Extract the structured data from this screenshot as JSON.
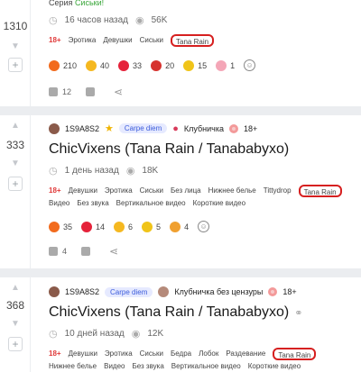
{
  "post1": {
    "votes": "1310",
    "series_label": "Серия",
    "series_name": "Сиськи!",
    "time": "16 часов назад",
    "views": "56K",
    "tags": [
      "18+",
      "Эротика",
      "Девушки",
      "Сиськи",
      "Tana Rain"
    ],
    "highlight_tag_index": 4,
    "reactions": [
      {
        "icon": "fire-emoji-icon",
        "color": "#f26b1d",
        "count": "210"
      },
      {
        "icon": "heart-eyes-emoji-icon",
        "color": "#f5b820",
        "count": "40"
      },
      {
        "icon": "heart-emoji-icon",
        "color": "#e5223a",
        "count": "33"
      },
      {
        "icon": "strawberry-emoji-icon",
        "color": "#d6322e",
        "count": "20"
      },
      {
        "icon": "drooling-emoji-icon",
        "color": "#f0c419",
        "count": "15"
      },
      {
        "icon": "pig-emoji-icon",
        "color": "#f4a6b7",
        "count": "1"
      }
    ],
    "comments": "12"
  },
  "post2": {
    "votes": "333",
    "author": "1S9A8S2",
    "author_badge": "Carpe diem",
    "community": "Клубничка",
    "rating": "18+",
    "title": "ChicVixens (Tana Rain / Tanababyxo)",
    "time": "1 день назад",
    "views": "18K",
    "tags": [
      "18+",
      "Девушки",
      "Эротика",
      "Сиськи",
      "Без лица",
      "Нижнее белье",
      "Tittydrop",
      "Tana Rain",
      "Видео",
      "Без звука",
      "Вертикальное видео",
      "Короткие видео"
    ],
    "highlight_tag_index": 7,
    "reactions": [
      {
        "icon": "fire-emoji-icon",
        "color": "#f26b1d",
        "count": "35"
      },
      {
        "icon": "heart-emoji-icon",
        "color": "#e5223a",
        "count": "14"
      },
      {
        "icon": "heart-eyes-emoji-icon",
        "color": "#f5b820",
        "count": "6"
      },
      {
        "icon": "drooling-emoji-icon",
        "color": "#f0c419",
        "count": "5"
      },
      {
        "icon": "blush-emoji-icon",
        "color": "#f0a030",
        "count": "4"
      }
    ],
    "comments": "4"
  },
  "post3": {
    "votes": "368",
    "author": "1S9A8S2",
    "author_badge": "Carpe diem",
    "community": "Клубничка без цензуры",
    "rating": "18+",
    "title": "ChicVixens (Tana Rain / Tanababyxo)",
    "time": "10 дней назад",
    "views": "12K",
    "tags": [
      "18+",
      "Девушки",
      "Эротика",
      "Сиськи",
      "Бедра",
      "Лобок",
      "Раздевание",
      "Tana Rain",
      "Нижнее белье",
      "Видео",
      "Без звука",
      "Вертикальное видео",
      "Короткие видео"
    ],
    "highlight_tag_index": 7
  },
  "icons": {
    "up": "▲",
    "down": "▼",
    "minus": "+",
    "clock": "◷",
    "eye": "◉",
    "comment": "▭",
    "save": "▣",
    "share": "⋖",
    "add_reaction": "☺",
    "link": "⚭"
  }
}
